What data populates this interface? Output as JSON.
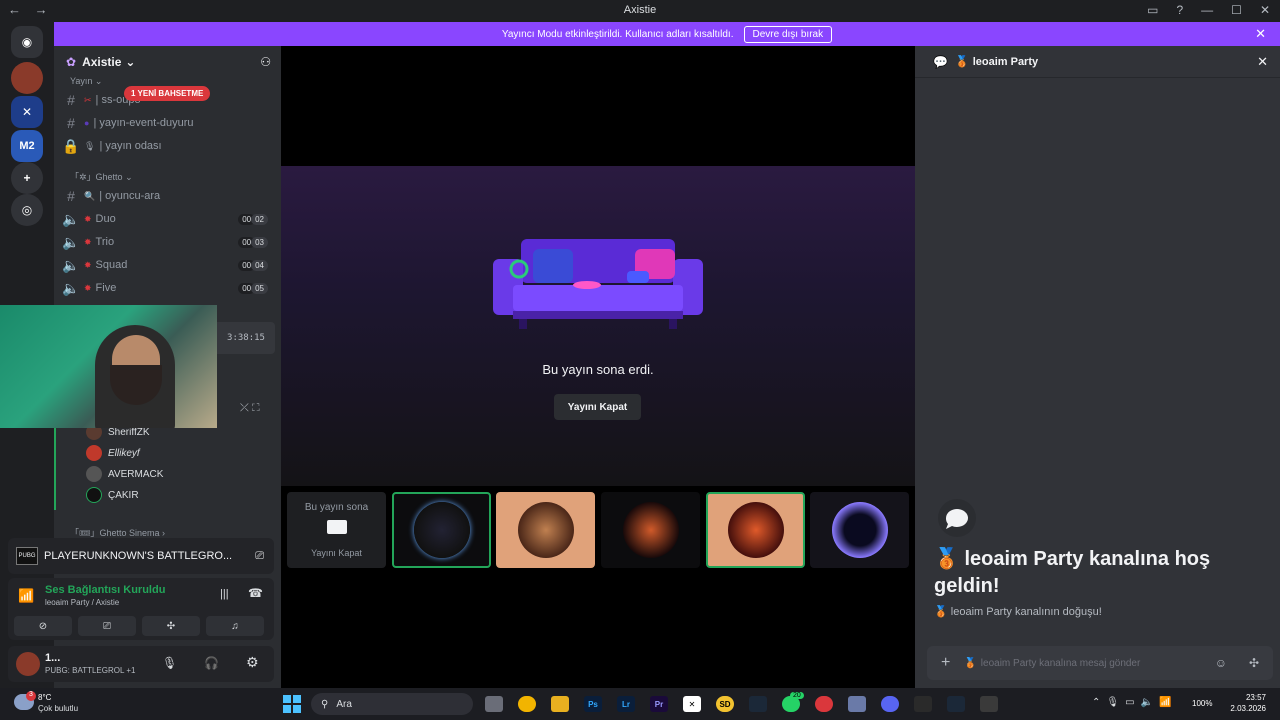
{
  "window": {
    "title": "Axistie",
    "back": "←",
    "forward": "→"
  },
  "banner": {
    "message": "Yayıncı Modu etkinleştirildi. Kullanıcı adları kısaltıldı.",
    "button": "Devre dışı bırak",
    "close": "✕"
  },
  "server": {
    "name": "Axistie",
    "caret": "⌄"
  },
  "sidebar": {
    "mention_badge": "1 YENİ BAHSETME",
    "category_top": "Yayın",
    "channels_top": [
      {
        "label": "| ss-oupo",
        "emoji": "✂"
      },
      {
        "label": "| yayın-event-duyuru",
        "emoji": "●"
      },
      {
        "label": "| yayın odası",
        "emoji": "🎙"
      }
    ],
    "category_ghetto": "Ghetto",
    "search_channel": "| oyuncu-ara",
    "voice_channels": [
      {
        "label": "Duo",
        "c1": "00",
        "c2": "02"
      },
      {
        "label": "Trio",
        "c1": "00",
        "c2": "03"
      },
      {
        "label": "Squad",
        "c1": "00",
        "c2": "04"
      },
      {
        "label": "Five",
        "c1": "00",
        "c2": "05"
      }
    ],
    "timer": "3:38:15",
    "members": [
      "SheriffZK",
      "Ellikeyf",
      "AVERMACK",
      "ÇAKIR"
    ],
    "category_cinema": "Ghetto Sinema"
  },
  "game_panel": {
    "title": "PLAYERUNKNOWN'S BATTLEGRO..."
  },
  "voice_panel": {
    "status": "Ses Bağlantısı Kuruldu",
    "location": "leoaim Party / Axistie"
  },
  "user_panel": {
    "name": "1...",
    "activity": "PUBG: BATTLEGROL +1"
  },
  "stream": {
    "end_text": "Bu yayın sona erdi.",
    "close_button": "Yayını Kapat",
    "tile_end_text": "Bu yayın sona",
    "tile_close_button": "Yayını Kapat"
  },
  "chat": {
    "header": "leoaim Party",
    "welcome_title": "leoaim Party kanalına hoş geldin!",
    "welcome_sub": "leoaim Party kanalının doğuşu!",
    "placeholder": "leoaim Party kanalına mesaj gönder"
  },
  "taskbar": {
    "weather_temp": "8°C",
    "weather_desc": "Çok bulutlu",
    "search": "Ara",
    "battery": "100%",
    "time": "23:57",
    "date": "2.03.2026",
    "badge_whatsapp": "20",
    "badge_weather": "3"
  },
  "colors": {
    "accent": "#8a46ff",
    "danger": "#da373c",
    "voice_green": "#23a559"
  }
}
